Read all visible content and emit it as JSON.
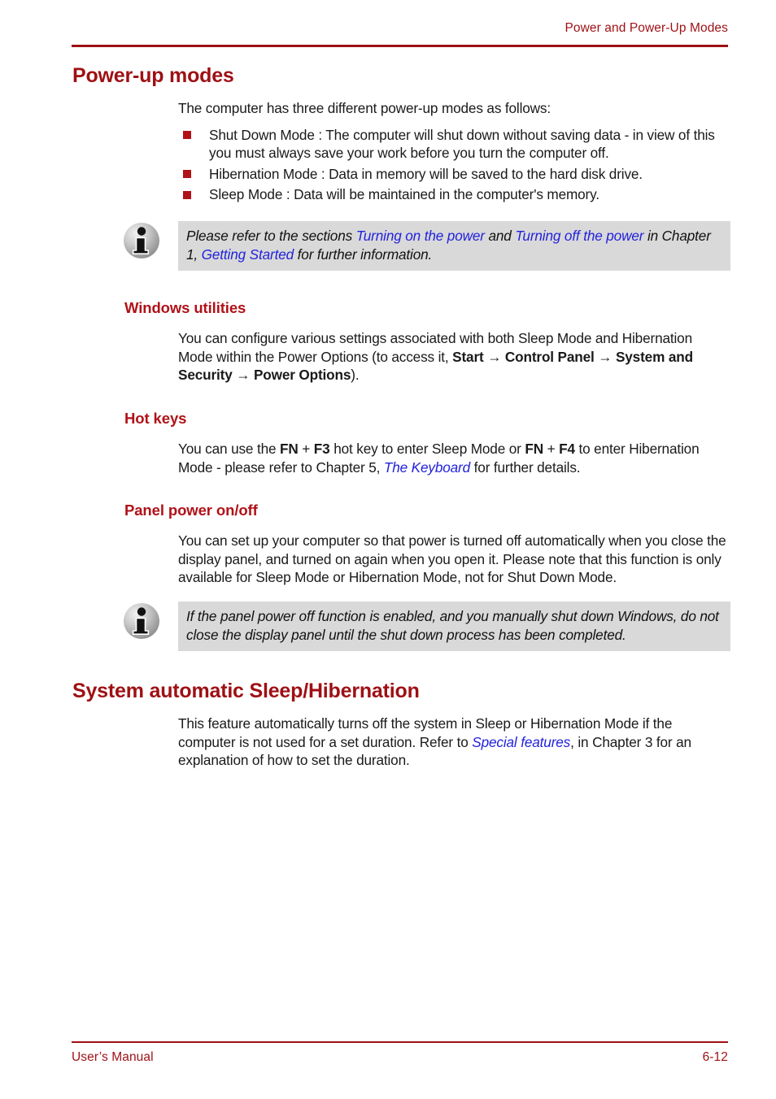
{
  "header": {
    "title": "Power and Power-Up Modes"
  },
  "footer": {
    "left": "User’s Manual",
    "right": "6-12"
  },
  "colors": {
    "heading_red": "#9E1014",
    "subheading_red": "#B01218",
    "rule_red": "#9E1014",
    "link_blue": "#2222DD",
    "note_background": "#D9D9D9",
    "bullet_red": "#B01218",
    "body_text": "#1a1a1a"
  },
  "sections": {
    "power_up_modes": {
      "heading": "Power-up modes",
      "intro": "The computer has three different power-up modes as follows:",
      "bullets": [
        "Shut Down Mode : The computer will shut down without saving data - in view of this you must always save your work before you turn the computer off.",
        "Hibernation Mode : Data in memory will be saved to the hard disk drive.",
        "Sleep Mode : Data will be maintained in the computer's memory."
      ],
      "note": {
        "icon": "info-icon",
        "text_1": "Please refer to the sections ",
        "link_1": "Turning on the power",
        "text_2": " and ",
        "link_2": "Turning off the power",
        "text_3": " in Chapter 1, ",
        "link_3": "Getting Started",
        "text_4": " for further information."
      }
    },
    "windows_utilities": {
      "heading": "Windows utilities",
      "text_1": "You can configure various settings associated with both Sleep Mode and Hibernation Mode within the Power Options (to access it, ",
      "bold_1": "Start",
      "arrow_1": " → ",
      "bold_2": "Control Panel",
      "arrow_2": " → ",
      "bold_3": "System and Security",
      "arrow_3": " → ",
      "bold_4": "Power Options",
      "text_2": ")."
    },
    "hot_keys": {
      "heading": "Hot keys",
      "text_1": "You can use the ",
      "bold_1": "FN",
      "text_2": " + ",
      "bold_2": "F3",
      "text_3": " hot key to enter Sleep Mode or ",
      "bold_3": "FN",
      "text_4": " + ",
      "bold_4": "F4",
      "text_5": " to enter Hibernation Mode - please refer to Chapter 5, ",
      "link_1": "The Keyboard",
      "text_6": " for further details."
    },
    "panel_power": {
      "heading": "Panel power on/off",
      "text": "You can set up your computer so that power is turned off automatically when you close the display panel, and turned on again when you open it. Please note that this function is only available for Sleep Mode or Hibernation Mode, not for Shut Down Mode.",
      "note": {
        "icon": "info-icon",
        "text": "If the panel power off function is enabled, and you manually shut down Windows, do not close the display panel until the shut down process has been completed."
      }
    },
    "system_automatic": {
      "heading": "System automatic Sleep/Hibernation",
      "text_1": "This feature automatically turns off the system in Sleep or Hibernation Mode if the computer is not used for a set duration. Refer to ",
      "link_1": "Special features",
      "text_2": ", in Chapter 3 for an explanation of how to set the duration."
    }
  }
}
